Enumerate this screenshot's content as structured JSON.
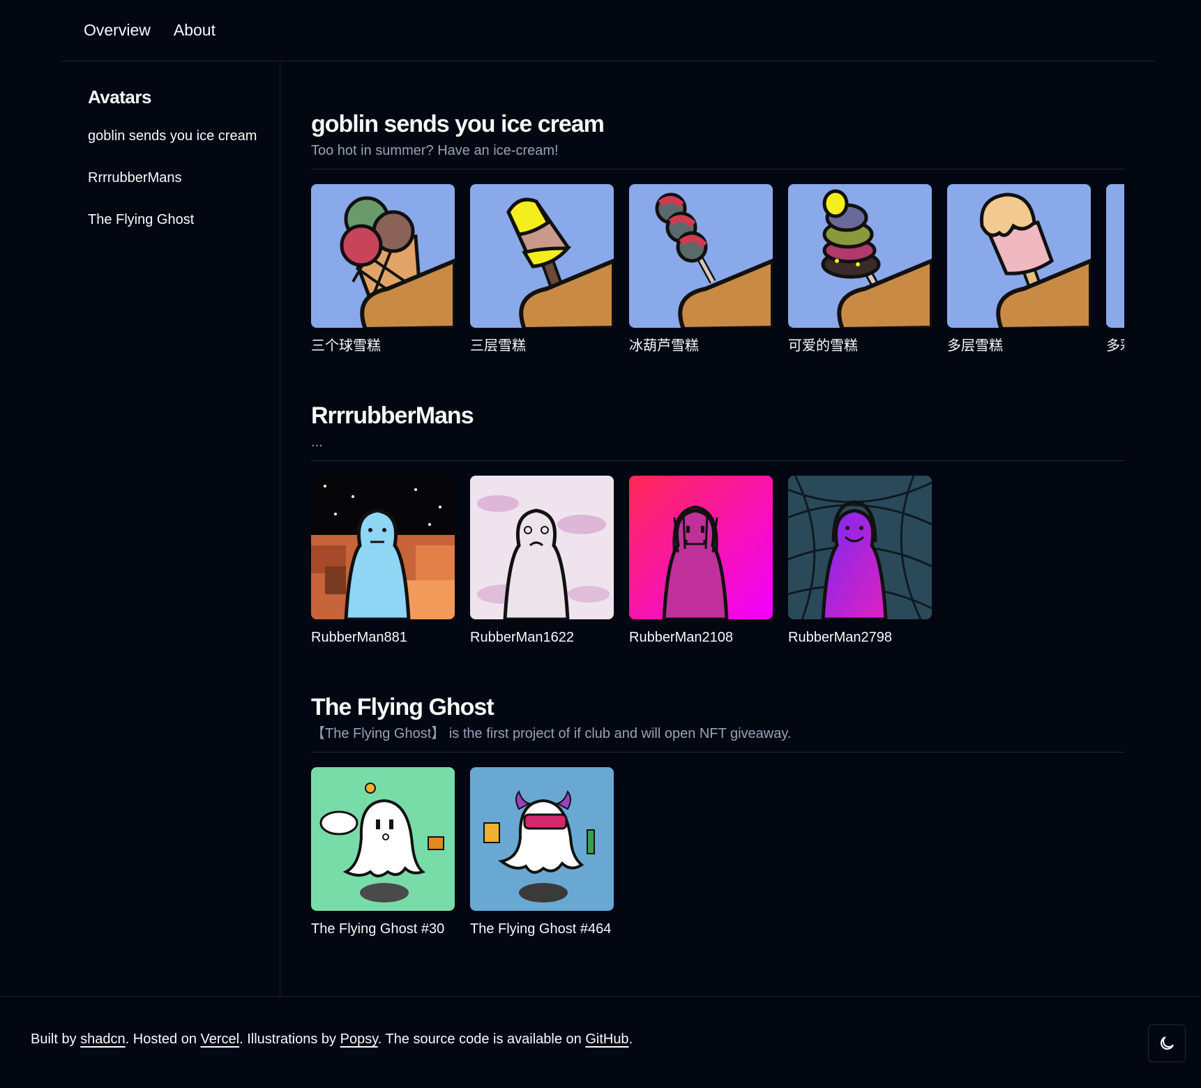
{
  "nav": {
    "overview": "Overview",
    "about": "About"
  },
  "sidebar": {
    "title": "Avatars",
    "items": [
      {
        "label": "goblin sends you ice cream"
      },
      {
        "label": "RrrrubberMans"
      },
      {
        "label": "The Flying Ghost"
      }
    ]
  },
  "sections": [
    {
      "title": "goblin sends you ice cream",
      "description": "Too hot in summer? Have an ice-cream!",
      "items": [
        {
          "caption": "三个球雪糕",
          "icon": "three-scoop-cone-icon"
        },
        {
          "caption": "三层雪糕",
          "icon": "layered-popsicle-icon"
        },
        {
          "caption": "冰葫芦雪糕",
          "icon": "candied-haws-icon"
        },
        {
          "caption": "可爱的雪糕",
          "icon": "cute-stacked-icecream-icon"
        },
        {
          "caption": "多层雪糕",
          "icon": "dripping-popsicle-icon"
        },
        {
          "caption": "多彩",
          "icon": "icecream-icon"
        }
      ]
    },
    {
      "title": "RrrrubberMans",
      "description": "...",
      "items": [
        {
          "caption": "RubberMan881",
          "icon": "rubberman-blue-icon"
        },
        {
          "caption": "RubberMan1622",
          "icon": "rubberman-white-icon"
        },
        {
          "caption": "RubberMan2108",
          "icon": "rubberman-magenta-icon"
        },
        {
          "caption": "RubberMan2798",
          "icon": "rubberman-purple-icon"
        }
      ]
    },
    {
      "title": "The Flying Ghost",
      "description": "【The Flying Ghost】 is the first project of if club and will open NFT giveaway.",
      "items": [
        {
          "caption": "The Flying Ghost #30",
          "icon": "ghost-genius-icon"
        },
        {
          "caption": "The Flying Ghost #464",
          "icon": "ghost-devil-icon"
        }
      ]
    }
  ],
  "footer": {
    "built_by": "Built by ",
    "shadcn": "shadcn",
    "hosted_on": ". Hosted on ",
    "vercel": "Vercel",
    "illustrations_by": ". Illustrations by ",
    "popsy": "Popsy",
    "source_code": ". The source code is available on ",
    "github": "GitHub",
    "end": "."
  },
  "theme_toggle_icon": "moon-icon",
  "colors": {
    "background": "#030711",
    "border": "#1e293b",
    "muted_text": "#94a3b8",
    "icecream_bg": "#8aa9ea"
  }
}
